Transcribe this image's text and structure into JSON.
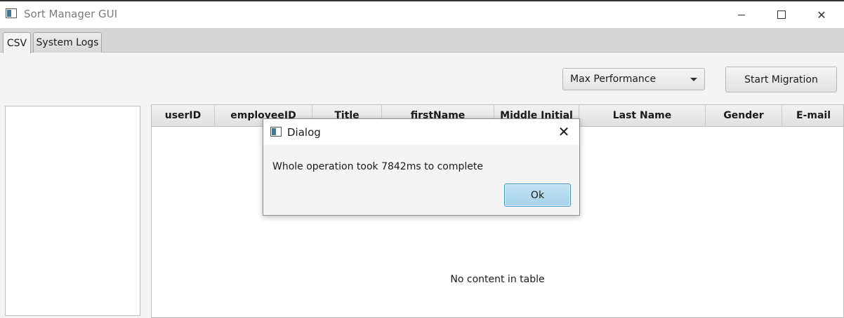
{
  "window": {
    "title": "Sort Manager GUI",
    "minimize_glyph": "",
    "close_glyph": "✕"
  },
  "tabs": [
    {
      "label": "CSV",
      "selected": true
    },
    {
      "label": "System Logs",
      "selected": false
    }
  ],
  "toolbar": {
    "performance_select": "Max Performance",
    "start_button": "Start Migration"
  },
  "table": {
    "columns": [
      "userID",
      "employeeID",
      "Title",
      "firstName",
      "Middle Initial",
      "Last Name",
      "Gender",
      "E-mail"
    ],
    "empty_message": "No content in table"
  },
  "dialog": {
    "title": "Dialog",
    "close_glyph": "✕",
    "message": "Whole operation took 7842ms to complete",
    "ok_label": "Ok"
  },
  "colors": {
    "ok_button_bg": "#b3dbef",
    "ok_button_border": "#3b8fc5",
    "tabbar_bg": "#d6d6d6"
  }
}
